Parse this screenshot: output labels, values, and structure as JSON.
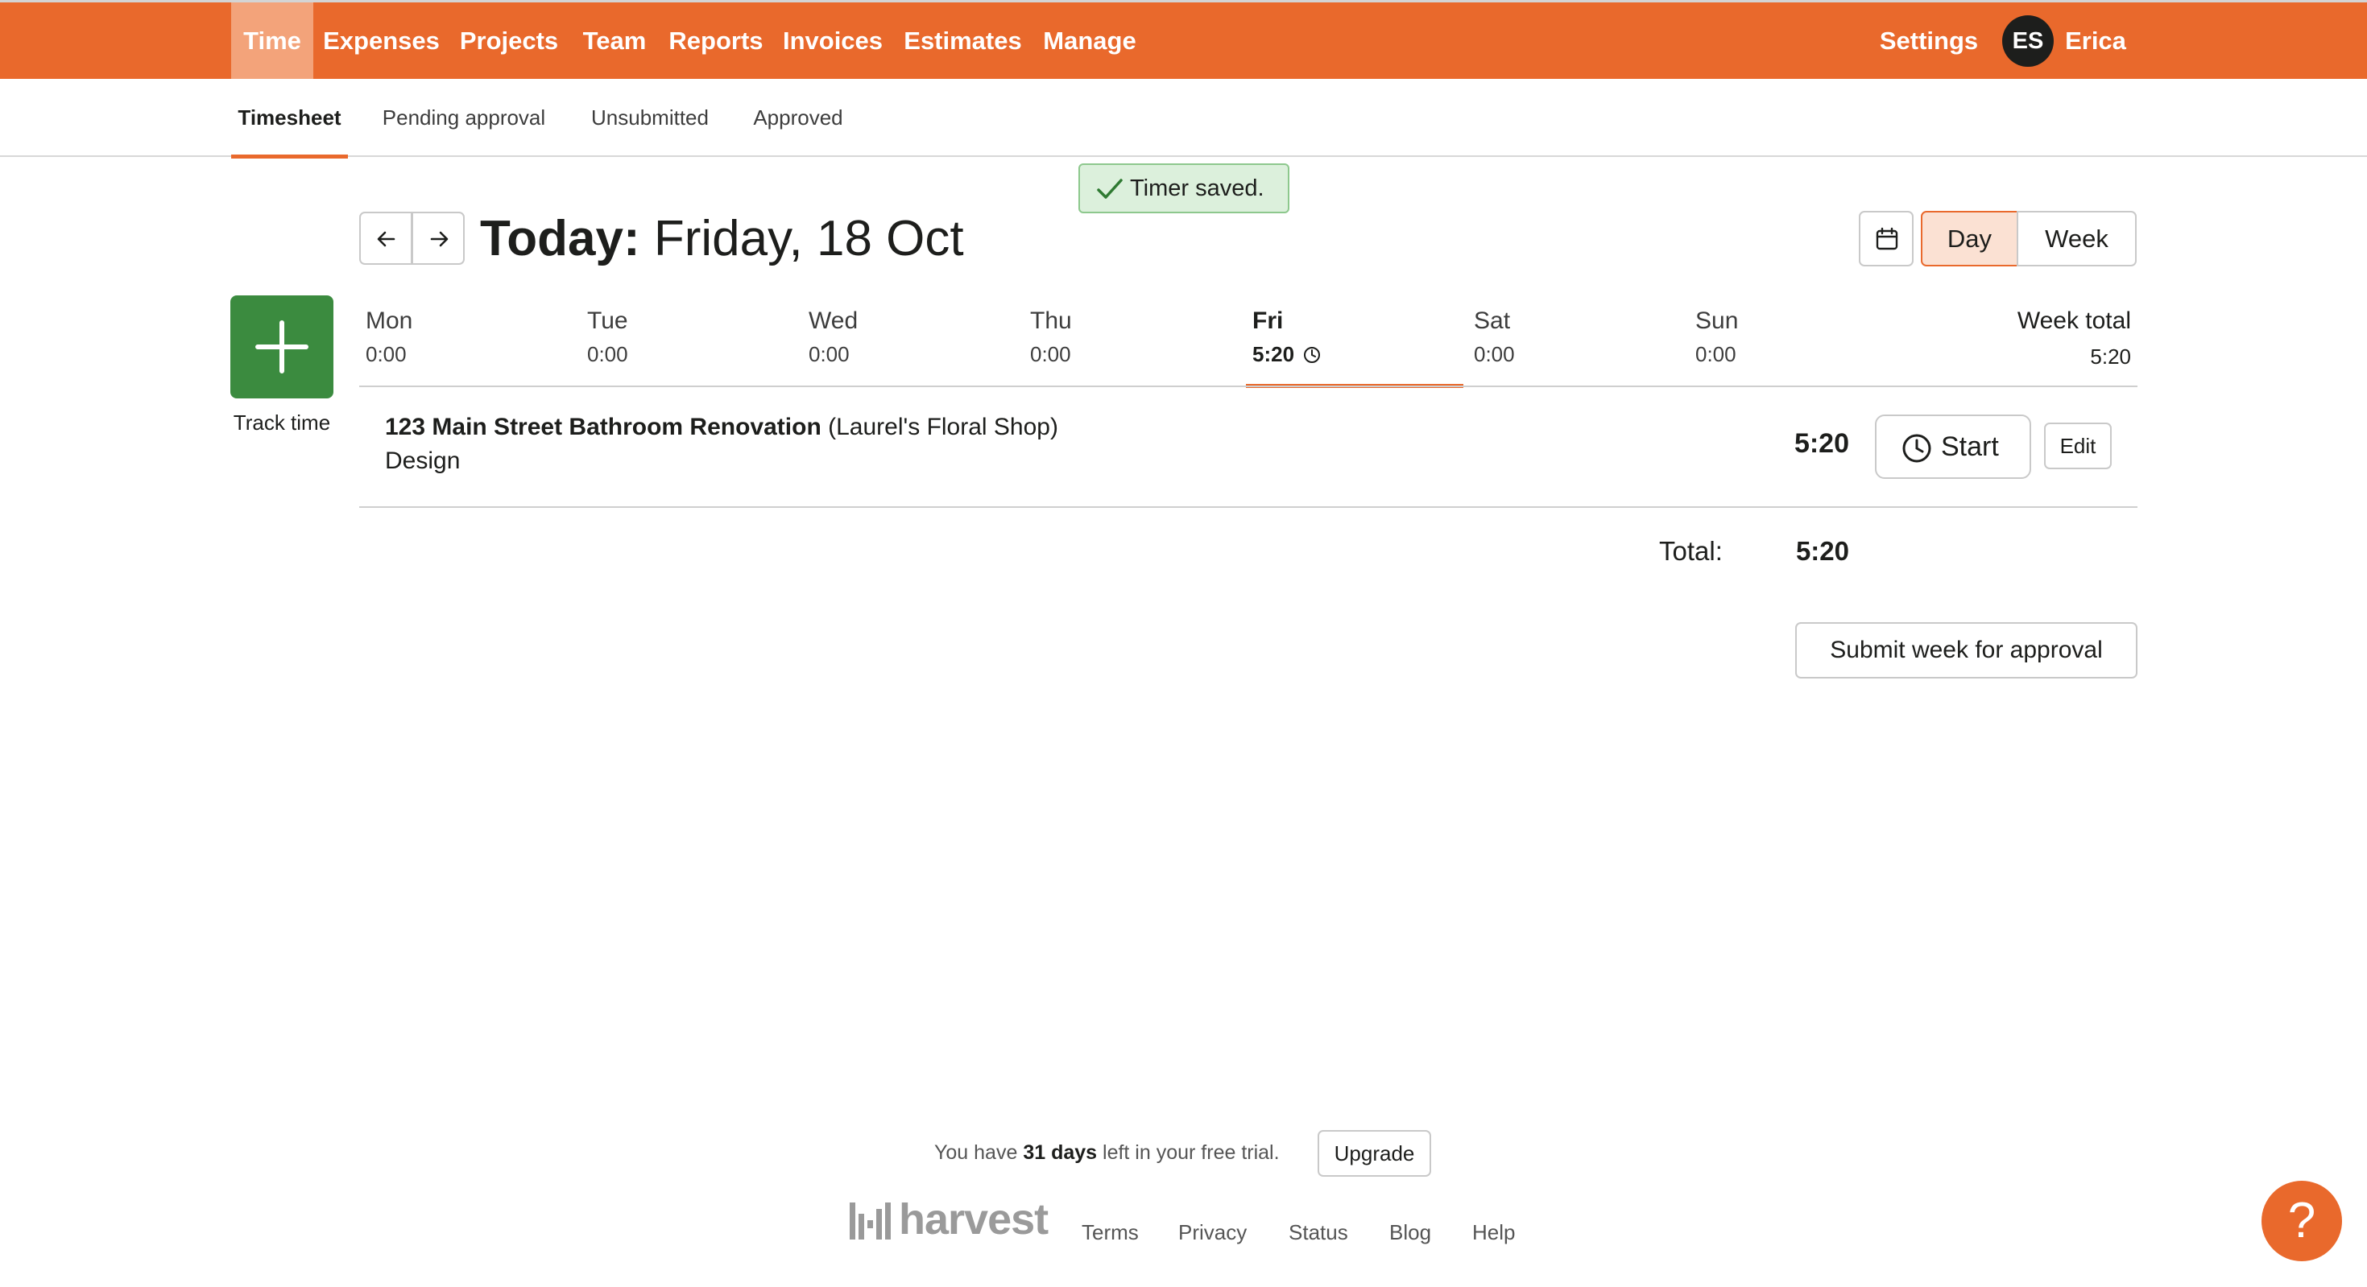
{
  "colors": {
    "brand": "#e9692c",
    "brand_active_tab": "#f3a37a",
    "track_green": "#3b8b3f",
    "toast_bg": "#dcf0dc"
  },
  "topnav": {
    "items": [
      "Time",
      "Expenses",
      "Projects",
      "Team",
      "Reports",
      "Invoices",
      "Estimates",
      "Manage"
    ],
    "active": "Time",
    "settings": "Settings",
    "avatar_initials": "ES",
    "user_name": "Erica"
  },
  "subnav": {
    "tabs": [
      "Timesheet",
      "Pending approval",
      "Unsubmitted",
      "Approved"
    ],
    "active": "Timesheet"
  },
  "toast": {
    "text": "Timer saved.",
    "icon": "check-icon"
  },
  "header": {
    "today_label": "Today:",
    "date": "Friday, 18 Oct",
    "prev_icon": "arrow-left-icon",
    "next_icon": "arrow-right-icon",
    "calendar_icon": "calendar-icon",
    "view_day": "Day",
    "view_week": "Week",
    "active_view": "Day"
  },
  "track": {
    "label": "Track time",
    "icon": "plus-icon"
  },
  "days": [
    {
      "name": "Mon",
      "hours": "0:00"
    },
    {
      "name": "Tue",
      "hours": "0:00"
    },
    {
      "name": "Wed",
      "hours": "0:00"
    },
    {
      "name": "Thu",
      "hours": "0:00"
    },
    {
      "name": "Fri",
      "hours": "5:20",
      "running_icon": "clock-icon"
    },
    {
      "name": "Sat",
      "hours": "0:00"
    },
    {
      "name": "Sun",
      "hours": "0:00"
    }
  ],
  "active_day": "Fri",
  "week_total": {
    "label": "Week total",
    "value": "5:20"
  },
  "entries": [
    {
      "project": "123 Main Street Bathroom Renovation",
      "client": "(Laurel's Floral Shop)",
      "task": "Design",
      "hours": "5:20",
      "start_label": "Start",
      "edit_label": "Edit"
    }
  ],
  "total": {
    "label": "Total:",
    "value": "5:20"
  },
  "submit_label": "Submit week for approval",
  "footer": {
    "trial_prefix": "You have",
    "trial_days": "31 days",
    "trial_suffix": "left in your free trial.",
    "upgrade": "Upgrade",
    "logo_text": "harvest",
    "links": [
      "Terms",
      "Privacy",
      "Status",
      "Blog",
      "Help"
    ]
  },
  "help_fab": "?"
}
